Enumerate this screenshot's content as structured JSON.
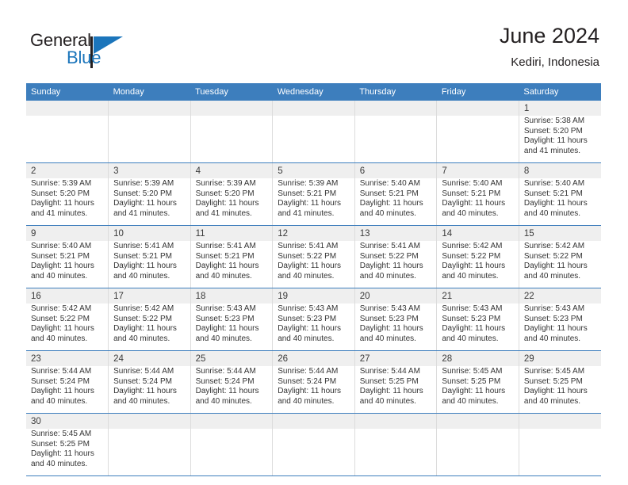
{
  "brand": {
    "name_top": "General",
    "name_bottom": "Blue",
    "colors": {
      "blue": "#1b75bb",
      "dark": "#231f20"
    }
  },
  "header": {
    "title": "June 2024",
    "subtitle": "Kediri, Indonesia"
  },
  "theme": {
    "header_bg": "#3d7ebd",
    "header_text": "#ffffff",
    "date_band_bg": "#efefef",
    "cell_bg": "#ffffff",
    "divider": "#dcdcdc"
  },
  "weekdays": [
    "Sunday",
    "Monday",
    "Tuesday",
    "Wednesday",
    "Thursday",
    "Friday",
    "Saturday"
  ],
  "weeks": [
    [
      {
        "day": "",
        "lines": []
      },
      {
        "day": "",
        "lines": []
      },
      {
        "day": "",
        "lines": []
      },
      {
        "day": "",
        "lines": []
      },
      {
        "day": "",
        "lines": []
      },
      {
        "day": "",
        "lines": []
      },
      {
        "day": "1",
        "lines": [
          "Sunrise: 5:38 AM",
          "Sunset: 5:20 PM",
          "Daylight: 11 hours",
          "and 41 minutes."
        ]
      }
    ],
    [
      {
        "day": "2",
        "lines": [
          "Sunrise: 5:39 AM",
          "Sunset: 5:20 PM",
          "Daylight: 11 hours",
          "and 41 minutes."
        ]
      },
      {
        "day": "3",
        "lines": [
          "Sunrise: 5:39 AM",
          "Sunset: 5:20 PM",
          "Daylight: 11 hours",
          "and 41 minutes."
        ]
      },
      {
        "day": "4",
        "lines": [
          "Sunrise: 5:39 AM",
          "Sunset: 5:20 PM",
          "Daylight: 11 hours",
          "and 41 minutes."
        ]
      },
      {
        "day": "5",
        "lines": [
          "Sunrise: 5:39 AM",
          "Sunset: 5:21 PM",
          "Daylight: 11 hours",
          "and 41 minutes."
        ]
      },
      {
        "day": "6",
        "lines": [
          "Sunrise: 5:40 AM",
          "Sunset: 5:21 PM",
          "Daylight: 11 hours",
          "and 40 minutes."
        ]
      },
      {
        "day": "7",
        "lines": [
          "Sunrise: 5:40 AM",
          "Sunset: 5:21 PM",
          "Daylight: 11 hours",
          "and 40 minutes."
        ]
      },
      {
        "day": "8",
        "lines": [
          "Sunrise: 5:40 AM",
          "Sunset: 5:21 PM",
          "Daylight: 11 hours",
          "and 40 minutes."
        ]
      }
    ],
    [
      {
        "day": "9",
        "lines": [
          "Sunrise: 5:40 AM",
          "Sunset: 5:21 PM",
          "Daylight: 11 hours",
          "and 40 minutes."
        ]
      },
      {
        "day": "10",
        "lines": [
          "Sunrise: 5:41 AM",
          "Sunset: 5:21 PM",
          "Daylight: 11 hours",
          "and 40 minutes."
        ]
      },
      {
        "day": "11",
        "lines": [
          "Sunrise: 5:41 AM",
          "Sunset: 5:21 PM",
          "Daylight: 11 hours",
          "and 40 minutes."
        ]
      },
      {
        "day": "12",
        "lines": [
          "Sunrise: 5:41 AM",
          "Sunset: 5:22 PM",
          "Daylight: 11 hours",
          "and 40 minutes."
        ]
      },
      {
        "day": "13",
        "lines": [
          "Sunrise: 5:41 AM",
          "Sunset: 5:22 PM",
          "Daylight: 11 hours",
          "and 40 minutes."
        ]
      },
      {
        "day": "14",
        "lines": [
          "Sunrise: 5:42 AM",
          "Sunset: 5:22 PM",
          "Daylight: 11 hours",
          "and 40 minutes."
        ]
      },
      {
        "day": "15",
        "lines": [
          "Sunrise: 5:42 AM",
          "Sunset: 5:22 PM",
          "Daylight: 11 hours",
          "and 40 minutes."
        ]
      }
    ],
    [
      {
        "day": "16",
        "lines": [
          "Sunrise: 5:42 AM",
          "Sunset: 5:22 PM",
          "Daylight: 11 hours",
          "and 40 minutes."
        ]
      },
      {
        "day": "17",
        "lines": [
          "Sunrise: 5:42 AM",
          "Sunset: 5:22 PM",
          "Daylight: 11 hours",
          "and 40 minutes."
        ]
      },
      {
        "day": "18",
        "lines": [
          "Sunrise: 5:43 AM",
          "Sunset: 5:23 PM",
          "Daylight: 11 hours",
          "and 40 minutes."
        ]
      },
      {
        "day": "19",
        "lines": [
          "Sunrise: 5:43 AM",
          "Sunset: 5:23 PM",
          "Daylight: 11 hours",
          "and 40 minutes."
        ]
      },
      {
        "day": "20",
        "lines": [
          "Sunrise: 5:43 AM",
          "Sunset: 5:23 PM",
          "Daylight: 11 hours",
          "and 40 minutes."
        ]
      },
      {
        "day": "21",
        "lines": [
          "Sunrise: 5:43 AM",
          "Sunset: 5:23 PM",
          "Daylight: 11 hours",
          "and 40 minutes."
        ]
      },
      {
        "day": "22",
        "lines": [
          "Sunrise: 5:43 AM",
          "Sunset: 5:23 PM",
          "Daylight: 11 hours",
          "and 40 minutes."
        ]
      }
    ],
    [
      {
        "day": "23",
        "lines": [
          "Sunrise: 5:44 AM",
          "Sunset: 5:24 PM",
          "Daylight: 11 hours",
          "and 40 minutes."
        ]
      },
      {
        "day": "24",
        "lines": [
          "Sunrise: 5:44 AM",
          "Sunset: 5:24 PM",
          "Daylight: 11 hours",
          "and 40 minutes."
        ]
      },
      {
        "day": "25",
        "lines": [
          "Sunrise: 5:44 AM",
          "Sunset: 5:24 PM",
          "Daylight: 11 hours",
          "and 40 minutes."
        ]
      },
      {
        "day": "26",
        "lines": [
          "Sunrise: 5:44 AM",
          "Sunset: 5:24 PM",
          "Daylight: 11 hours",
          "and 40 minutes."
        ]
      },
      {
        "day": "27",
        "lines": [
          "Sunrise: 5:44 AM",
          "Sunset: 5:25 PM",
          "Daylight: 11 hours",
          "and 40 minutes."
        ]
      },
      {
        "day": "28",
        "lines": [
          "Sunrise: 5:45 AM",
          "Sunset: 5:25 PM",
          "Daylight: 11 hours",
          "and 40 minutes."
        ]
      },
      {
        "day": "29",
        "lines": [
          "Sunrise: 5:45 AM",
          "Sunset: 5:25 PM",
          "Daylight: 11 hours",
          "and 40 minutes."
        ]
      }
    ],
    [
      {
        "day": "30",
        "lines": [
          "Sunrise: 5:45 AM",
          "Sunset: 5:25 PM",
          "Daylight: 11 hours",
          "and 40 minutes."
        ]
      },
      {
        "day": "",
        "lines": []
      },
      {
        "day": "",
        "lines": []
      },
      {
        "day": "",
        "lines": []
      },
      {
        "day": "",
        "lines": []
      },
      {
        "day": "",
        "lines": []
      },
      {
        "day": "",
        "lines": []
      }
    ]
  ]
}
